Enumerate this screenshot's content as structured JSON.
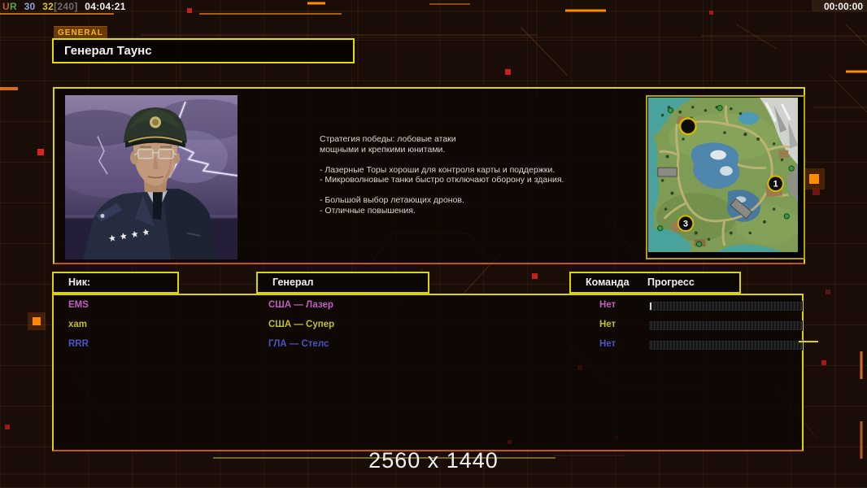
{
  "top_bar": {
    "debug": {
      "u": "U",
      "r": "R",
      "fps": "30",
      "frame": "32",
      "cap": "[240]",
      "time": "04:04:21"
    },
    "clock": "00:00:00"
  },
  "header": {
    "tab_label": "GENERAL",
    "general_name": "Генерал Таунс"
  },
  "bio": {
    "text": "Стратегия победы: лобовые атаки\nмощными и крепкими юнитами.\n\n- Лазерные Торы хороши для контроля карты и поддержки.\n- Микроволновые танки быстро отключают оборону и здания.\n\n- Большой выбор летающих дронов.\n- Отличные повышения."
  },
  "map": {
    "marker_1": "1",
    "marker_3": "3"
  },
  "columns": {
    "nick": "Ник:",
    "general": "Генерал",
    "team": "Команда",
    "progress": "Прогресс"
  },
  "players": {
    "rows": [
      {
        "nick": "EMS",
        "general": "США — Лазер",
        "team": "Нет",
        "color": "#c25fc2"
      },
      {
        "nick": "xam",
        "general": "США — Супер",
        "team": "Нет",
        "color": "#c2c226"
      },
      {
        "nick": "RRR",
        "general": "ГЛА — Стелс",
        "team": "Нет",
        "color": "#4a55c8"
      }
    ]
  },
  "watermark": "2560 x 1440",
  "colors": {
    "debug_u": "#cc5a20",
    "debug_r": "#4faa38",
    "debug_fps": "#8fa6d6",
    "debug_frame": "#d3c23a",
    "debug_cap": "#6f6f6f",
    "accent_yellow": "#d9d600",
    "accent_orange": "#c87818"
  }
}
